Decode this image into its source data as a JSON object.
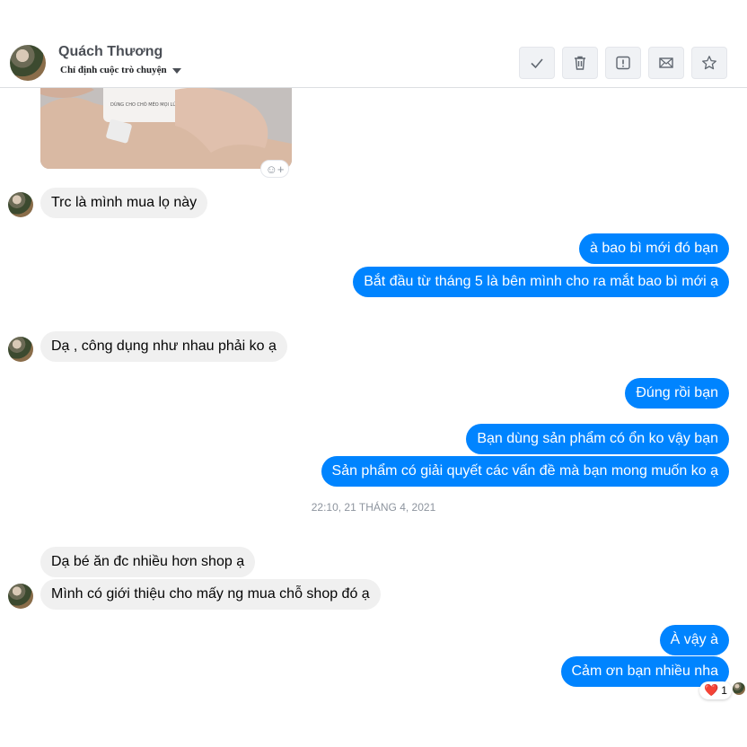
{
  "header": {
    "contact_name": "Quách Thương",
    "subtitle": "Chỉ định cuộc trò chuyện",
    "actions": [
      {
        "name": "check-icon"
      },
      {
        "name": "trash-icon"
      },
      {
        "name": "report-icon"
      },
      {
        "name": "mail-icon"
      },
      {
        "name": "star-icon"
      }
    ]
  },
  "photo": {
    "visible_text": "DÙNG CHO CHÓ MÈO MỌI LỨA TUỔI"
  },
  "messages": [
    {
      "from": "contact",
      "text": "Trc là mình mua lọ này"
    },
    {
      "from": "me",
      "text": "à bao bì mới đó bạn"
    },
    {
      "from": "me",
      "text": "Bắt đầu từ tháng 5 là bên mình cho ra mắt bao bì mới ạ"
    },
    {
      "from": "contact",
      "text": "Dạ , công dụng như nhau phải ko ạ"
    },
    {
      "from": "me",
      "text": "Đúng rồi bạn"
    },
    {
      "from": "me",
      "text": "Bạn dùng sản phẩm có ổn ko vậy bạn"
    },
    {
      "from": "me",
      "text": "Sản phẩm có giải quyết các vấn đề mà bạn mong muốn ko ạ"
    },
    {
      "from": "contact",
      "text": "Dạ bé ăn đc nhiều hơn shop ạ"
    },
    {
      "from": "contact",
      "text": "Mình có giới thiệu cho mấy ng mua chỗ shop đó ạ"
    },
    {
      "from": "me",
      "text": "À vậy à"
    },
    {
      "from": "me",
      "text": "Cảm ơn bạn nhiều nha"
    }
  ],
  "timestamp": "22:10, 21 THÁNG 4, 2021",
  "reaction": {
    "emoji": "❤️",
    "count": "1"
  },
  "colors": {
    "outgoing": "#0084ff",
    "incoming": "#f0f0f0"
  }
}
